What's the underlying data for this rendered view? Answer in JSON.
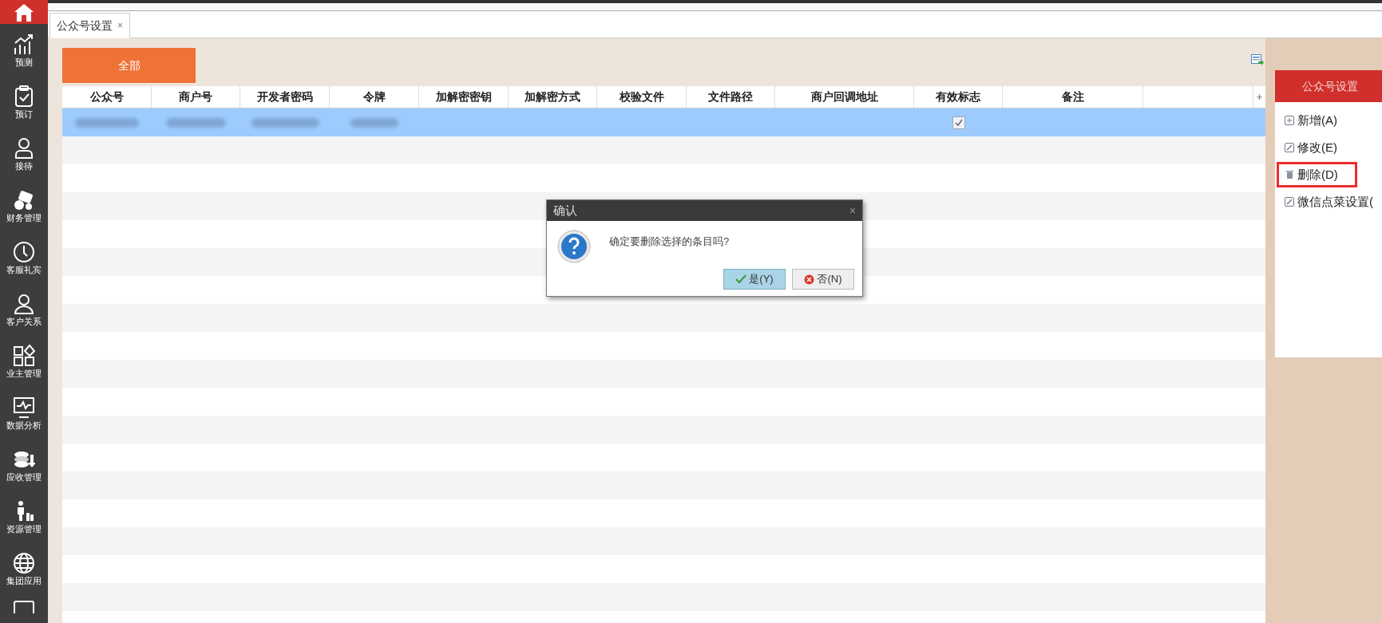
{
  "sidebar": {
    "items": [
      {
        "label": "预测"
      },
      {
        "label": "预订"
      },
      {
        "label": "接待"
      },
      {
        "label": "财务管理"
      },
      {
        "label": "客服礼宾"
      },
      {
        "label": "客户关系"
      },
      {
        "label": "业主管理"
      },
      {
        "label": "数据分析"
      },
      {
        "label": "应收管理"
      },
      {
        "label": "资源管理"
      },
      {
        "label": "集团应用"
      }
    ]
  },
  "tabs": [
    {
      "label": "公众号设置",
      "close": "×",
      "selected": true
    }
  ],
  "filter_button": "全部",
  "table": {
    "columns": [
      "公众号",
      "商户号",
      "开发者密码",
      "令牌",
      "加解密密钥",
      "加解密方式",
      "校验文件",
      "文件路径",
      "商户回调地址",
      "有效标志",
      "备注"
    ],
    "add_column": "+",
    "rows": [
      {
        "selected": true,
        "valid": true
      }
    ]
  },
  "panel": {
    "title": "公众号设置",
    "items": [
      {
        "label": "新增(A)",
        "highlighted": false
      },
      {
        "label": "修改(E)",
        "highlighted": false
      },
      {
        "label": "删除(D)",
        "highlighted": true
      },
      {
        "label": "微信点菜设置(",
        "highlighted": false
      }
    ]
  },
  "dialog": {
    "title": "确认",
    "close": "×",
    "message": "确定要删除选择的条目吗?",
    "buttons": [
      {
        "kind": "yes",
        "label": "是(Y)"
      },
      {
        "kind": "no",
        "label": "否(N)"
      }
    ]
  }
}
